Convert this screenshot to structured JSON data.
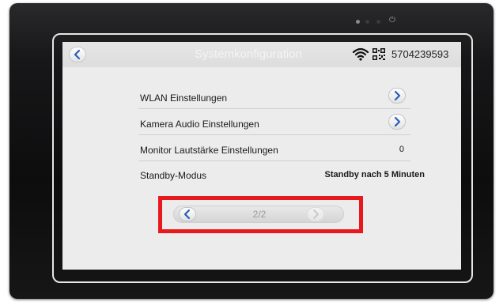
{
  "header": {
    "title": "Systemkonfiguration",
    "device_id": "5704239593",
    "icons": {
      "back": "chevron-left-icon",
      "wifi": "wifi-icon",
      "qr": "qr-code-icon"
    }
  },
  "settings": [
    {
      "label": "WLAN Einstellungen",
      "value": "",
      "control": "chevron-right-icon"
    },
    {
      "label": "Kamera Audio Einstellungen",
      "value": "",
      "control": "chevron-right-icon"
    },
    {
      "label": "Monitor Lautstärke Einstellungen",
      "value": "0",
      "control": ""
    },
    {
      "label": "Standby-Modus",
      "value": "Standby nach 5 Minuten",
      "control": ""
    }
  ],
  "pager": {
    "text": "2/2"
  },
  "colors": {
    "accent": "#2a5fb8",
    "highlight": "#e8191c",
    "device_body": "#121213",
    "screen_bg": "#ececec"
  }
}
